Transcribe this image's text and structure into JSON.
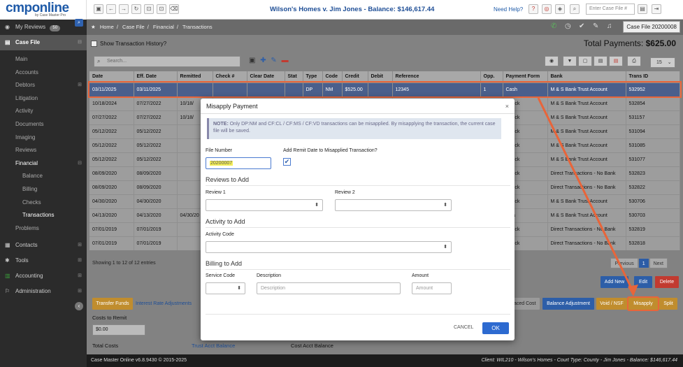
{
  "app": {
    "logo_text": "cmponline",
    "logo_sub": "by Case Master Pro",
    "title": "Wilson's Homes v. Jim Jones - Balance: $146,617.44",
    "need_help": "Need Help?",
    "search_case_placeholder": "Enter Case File #",
    "case_file_button": "Case File 20200008"
  },
  "sidebar": {
    "my_reviews": "My Reviews",
    "my_reviews_count": "50",
    "case_file": "Case File",
    "items": [
      "Main",
      "Accounts",
      "Debtors",
      "Litigation",
      "Activity",
      "Documents",
      "Imaging",
      "Reviews",
      "Financial"
    ],
    "financial_sub": [
      "Balance",
      "Billing",
      "Checks",
      "Transactions"
    ],
    "problems": "Problems",
    "bottom": [
      "Contacts",
      "Tools",
      "Accounting",
      "Administration"
    ]
  },
  "breadcrumb": [
    "Home",
    "Case File",
    "Financial",
    "Transactions"
  ],
  "main": {
    "show_history": "Show Transaction History?",
    "total_label": "Total Payments:",
    "total_value": "$625.00",
    "search_placeholder": "Search...",
    "per_page": "15",
    "columns": [
      "Date",
      "Eff. Date",
      "Remitted",
      "Check #",
      "Clear Date",
      "Stat",
      "Type",
      "Code",
      "Credit",
      "Debit",
      "Reference",
      "Opp.",
      "Payment Form",
      "Bank",
      "Trans ID"
    ],
    "rows": [
      [
        "03/11/2025",
        "03/11/2025",
        "",
        "",
        "",
        "",
        "DP",
        "NM",
        "$525.00",
        "",
        "12345",
        "1",
        "Cash",
        "M & S Bank Trust Account",
        "532952"
      ],
      [
        "10/18/2024",
        "07/27/2022",
        "10/18/",
        "",
        "",
        "",
        "",
        "",
        "",
        "",
        "",
        "",
        "Check",
        "M & S Bank Trust Account",
        "532854"
      ],
      [
        "07/27/2022",
        "07/27/2022",
        "10/18/",
        "",
        "",
        "",
        "",
        "",
        "",
        "",
        "",
        "",
        "Check",
        "M & S Bank Trust Account",
        "531157"
      ],
      [
        "05/12/2022",
        "05/12/2022",
        "",
        "",
        "",
        "",
        "",
        "",
        "",
        "",
        "",
        "",
        "Check",
        "M & S Bank Trust Account",
        "531094"
      ],
      [
        "05/12/2022",
        "05/12/2022",
        "",
        "",
        "",
        "",
        "",
        "",
        "",
        "",
        "",
        "",
        "Check",
        "M & S Bank Trust Account",
        "531085"
      ],
      [
        "05/12/2022",
        "05/12/2022",
        "",
        "",
        "",
        "",
        "",
        "",
        "",
        "",
        "",
        "",
        "Check",
        "M & S Bank Trust Account",
        "531077"
      ],
      [
        "08/09/2020",
        "08/09/2020",
        "",
        "",
        "",
        "",
        "",
        "",
        "",
        "",
        "",
        "",
        "Check",
        "Direct Transactions - No Bank",
        "532823"
      ],
      [
        "08/09/2020",
        "08/09/2020",
        "",
        "",
        "",
        "",
        "",
        "",
        "",
        "",
        "",
        "",
        "Check",
        "Direct Transactions - No Bank",
        "532822"
      ],
      [
        "04/30/2020",
        "04/30/2020",
        "",
        "",
        "",
        "",
        "",
        "",
        "",
        "",
        "",
        "",
        "Check",
        "M & S Bank Trust Account",
        "530706"
      ],
      [
        "04/13/2020",
        "04/13/2020",
        "04/30/20",
        "",
        "",
        "",
        "",
        "",
        "",
        "",
        "",
        "",
        "Visa",
        "M & S Bank Trust Account",
        "530703"
      ],
      [
        "07/01/2019",
        "07/01/2019",
        "",
        "",
        "",
        "",
        "",
        "",
        "",
        "",
        "",
        "",
        "Check",
        "Direct Transactions - No Bank",
        "532819"
      ],
      [
        "07/01/2019",
        "07/01/2019",
        "",
        "",
        "",
        "",
        "",
        "",
        "",
        "",
        "",
        "",
        "Check",
        "Direct Transactions - No Bank",
        "532818"
      ]
    ],
    "showing": "Showing 1 to 12 of 12 entries",
    "pager": {
      "prev": "Previous",
      "page": "1",
      "next": "Next"
    },
    "buttons": {
      "add_new": "Add New",
      "edit": "Edit",
      "delete": "Delete",
      "transfer_funds": "Transfer Funds",
      "interest_rate": "Interest Rate Adjustments",
      "replaced_cost": "placed Cost",
      "balance_adjustment": "Balance Adjustment",
      "void_nsf": "Void / NSF",
      "misapply": "Misapply",
      "split": "Split"
    },
    "costs_to_remit_label": "Costs to Remit",
    "costs_to_remit_value": "$0.00",
    "total_costs": "Total Costs",
    "trust_acct_balance": "Trust Acct Balance",
    "cost_acct_balance": "Cost Acct Balance"
  },
  "modal": {
    "title": "Misapply Payment",
    "note_strong": "NOTE:",
    "note_text": "Only DP:NM and CF:CL / CF:MS / CF:VD transactions can be misapplied. By misapplying the transaction, the current case file will be saved.",
    "file_number_label": "File Number",
    "file_number_value": "20200007",
    "add_remit_label": "Add Remit Date to Misapplied Transaction?",
    "reviews_section": "Reviews to Add",
    "review1": "Review 1",
    "review2": "Review 2",
    "activity_section": "Activity to Add",
    "activity_code": "Activity Code",
    "billing_section": "Billing to Add",
    "service_code": "Service Code",
    "description": "Description",
    "description_placeholder": "Description",
    "amount": "Amount",
    "amount_placeholder": "Amount",
    "cancel": "CANCEL",
    "ok": "OK"
  },
  "footer": {
    "left": "Case Master Online v6.8.9430 © 2015-2025",
    "right": "Client: WIL210 - Wilson's Homes - Court Type: County - Jim Jones - Balance: $146,617.44"
  },
  "colors": {
    "accent": "#2d5ea8",
    "annotation_arrow": "#e8653a",
    "sidebar_bg": "#2b2b2b"
  }
}
